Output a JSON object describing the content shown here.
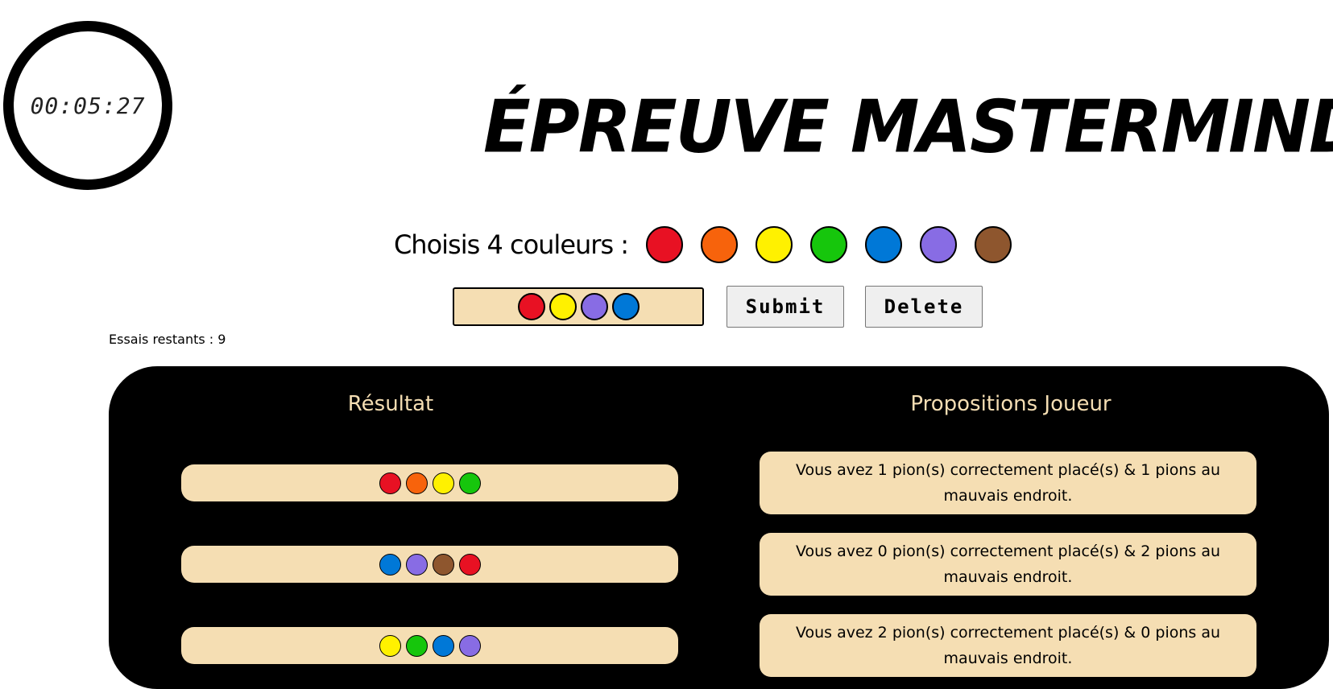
{
  "timer": {
    "time": "00:05:27"
  },
  "title": "ÉPREUVE MASTERMIND",
  "picker": {
    "label": "Choisis 4 couleurs :",
    "colors": [
      {
        "name": "red",
        "hex": "#e81123"
      },
      {
        "name": "orange",
        "hex": "#f7630c"
      },
      {
        "name": "yellow",
        "hex": "#fff100"
      },
      {
        "name": "green",
        "hex": "#16c60c"
      },
      {
        "name": "blue",
        "hex": "#0078d7"
      },
      {
        "name": "purple",
        "hex": "#886ce4"
      },
      {
        "name": "brown",
        "hex": "#8e562e"
      }
    ]
  },
  "current_guess": [
    "#e81123",
    "#fff100",
    "#886ce4",
    "#0078d7"
  ],
  "buttons": {
    "submit": "Submit",
    "delete": "Delete"
  },
  "tries": "Essais restants : 9",
  "board": {
    "left_header": "Résultat",
    "right_header": "Propositions Joueur",
    "rows": [
      {
        "pegs": [
          "#e81123",
          "#f7630c",
          "#fff100",
          "#16c60c"
        ],
        "feedback": "Vous avez 1 pion(s) correctement placé(s) & 1 pions au mauvais endroit."
      },
      {
        "pegs": [
          "#0078d7",
          "#886ce4",
          "#8e562e",
          "#e81123"
        ],
        "feedback": "Vous avez 0 pion(s) correctement placé(s) & 2 pions au mauvais endroit."
      },
      {
        "pegs": [
          "#fff100",
          "#16c60c",
          "#0078d7",
          "#886ce4"
        ],
        "feedback": "Vous avez 2 pion(s) correctement placé(s) & 0 pions au mauvais endroit."
      }
    ]
  }
}
